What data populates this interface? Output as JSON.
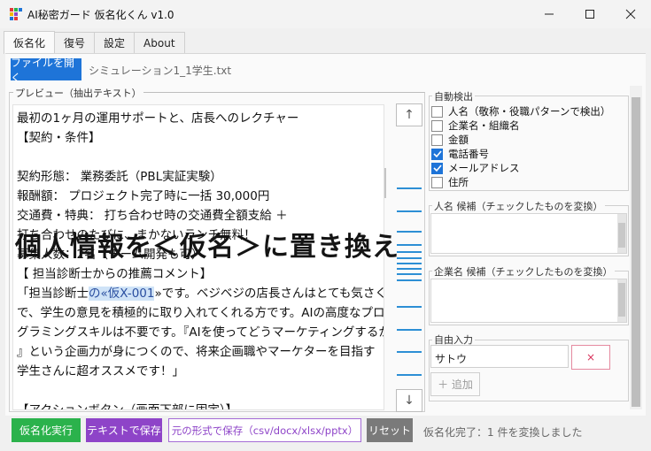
{
  "window": {
    "title": "AI秘密ガード 仮名化くん v1.0",
    "minimize_icon": "minimize-icon",
    "maximize_icon": "maximize-icon",
    "close_icon": "close-icon"
  },
  "tabs": [
    {
      "label": "仮名化",
      "active": true
    },
    {
      "label": "復号",
      "active": false
    },
    {
      "label": "設定",
      "active": false
    },
    {
      "label": "About",
      "active": false
    }
  ],
  "toolbar": {
    "open_file_label": "ファイルを開く",
    "filename": "シミュレーション1_1学生.txt"
  },
  "preview": {
    "legend": "プレビュー（抽出テキスト）",
    "lines": [
      "最初の1ヶ月の運用サポートと、店長へのレクチャー",
      "【契約・条件】",
      "",
      "契約形態： 業務委託（PBL実証実験）",
      "報酬額： プロジェクト完了時に一括 30,000円",
      "交通費・特典： 打ち合わせ時の交通費全額支給 ＋",
      "打ち合わせのたびに、まかないランチ無料！",
      "募集人数：2名（チーム開発も可）",
      "【 担当診断士からの推薦コメント】",
      "「担当診断士の«仮X-001»です。ベジベジの店長さんはとても気さく",
      "で、学生の意見を積極的に取り入れてくれる方です。AIの高度なプロ",
      "グラミングスキルは不要です。『AIを使ってどうマーケティングするか",
      "』という企画力が身につくので、将来企画職やマーケターを目指す",
      "学生さんに超オススメです！」",
      "",
      "【アクションボタン（画面下部に固定）】"
    ],
    "highlight_prefix": "「担当診断士",
    "highlight": "の«仮X-001",
    "highlight_suffix": "»です。ベジベジの店長さんはとても気さく",
    "scroll_up_icon": "arrow-up-icon",
    "scroll_down_icon": "arrow-down-icon",
    "up_glyph": "↑",
    "down_glyph": "↓"
  },
  "overlay_caption": "個人情報を＜仮名＞に置き換え",
  "auto_detect": {
    "legend": "自動検出",
    "items": [
      {
        "label": "人名（敬称・役職パターンで検出）",
        "checked": false
      },
      {
        "label": "企業名・組織名",
        "checked": false
      },
      {
        "label": "金額",
        "checked": false
      },
      {
        "label": "電話番号",
        "checked": true
      },
      {
        "label": "メールアドレス",
        "checked": true
      },
      {
        "label": "住所",
        "checked": false
      }
    ]
  },
  "person_candidates": {
    "legend": "人名 候補（チェックしたものを変換）"
  },
  "company_candidates": {
    "legend": "企業名 候補（チェックしたものを変換）"
  },
  "free_input": {
    "legend": "自由入力",
    "value": "サトウ",
    "clear_label": "×",
    "add_label": "＋ 追加"
  },
  "bottom": {
    "run_label": "仮名化実行",
    "save_text_label": "テキストで保存",
    "save_original_label": "元の形式で保存（csv/docx/xlsx/pptx）",
    "reset_label": "リセット",
    "status": "仮名化完了：1 件を変換しました"
  },
  "colors": {
    "accent_blue": "#1e74d8",
    "run_green": "#2bb24c",
    "save_purple": "#8e44c8",
    "reset_gray": "#7a7a7a",
    "marker_blue": "#2d8fd5"
  }
}
